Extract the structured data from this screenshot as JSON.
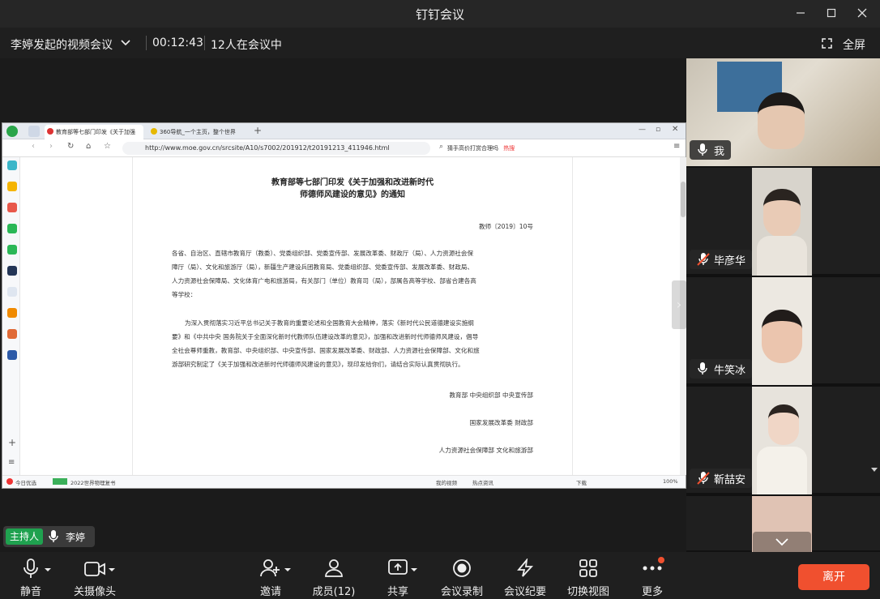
{
  "window": {
    "title": "钉钉会议"
  },
  "meeting": {
    "name": "李婷发起的视频会议",
    "duration": "00:12:43",
    "count": "12人在会议中",
    "fullscreen": "全屏"
  },
  "browser": {
    "tab1": "教育部等七部门印发《关于加强",
    "tab2": "360导航_一个主页，整个世界",
    "url": "http://www.moe.gov.cn/srcsite/A10/s7002/201912/t20191213_411946.html",
    "search": "猜手高价打赏合理吗",
    "hot": "热搜",
    "status_left": "今日优选",
    "status_mid": "2022世界物理复书",
    "status_video": "我的视频",
    "status_news": "热点资讯",
    "status_download": "下载",
    "zoom": "100%"
  },
  "document": {
    "title1": "教育部等七部门印发《关于加强和改进新时代",
    "title2": "师德师风建设的意见》的通知",
    "docno": "教师〔2019〕10号",
    "p1": [
      "各省、自治区、直辖市教育厅（教委）、党委组织部、党委宣传部、发展改革委、财政厅（局）、人力资源社会保",
      "障厅（局）、文化和旅游厅（局），新疆生产建设兵团教育局、党委组织部、党委宣传部、发展改革委、财政局、",
      "人力资源社会保障局、文化体育广电和旅游局，有关部门（单位）教育司（局），部属各高等学校、部省合建各高",
      "等学校："
    ],
    "p2": [
      "为深入贯彻落实习近平总书记关于教育的重要论述和全国教育大会精神，落实《新时代公民道德建设实施纲",
      "要》和《中共中央 国务院关于全面深化新时代教师队伍建设改革的意见》，加强和改进新时代师德师风建设，倡导",
      "全社会尊师重教，教育部、中央组织部、中央宣传部、国家发展改革委、财政部、人力资源社会保障部、文化和旅",
      "游部研究制定了《关于加强和改进新时代师德师风建设的意见》，现印发给你们，请结合实际认真贯彻执行。"
    ],
    "sign1": "教育部 中央组织部 中央宣传部",
    "sign2": "国家发展改革委 财政部",
    "sign3": "人力资源社会保障部 文化和旅游部"
  },
  "host": {
    "badge": "主持人",
    "name": "李婷"
  },
  "participants": [
    {
      "name": "我"
    },
    {
      "name": "毕彦华"
    },
    {
      "name": "牛笑冰"
    },
    {
      "name": "靳喆安"
    }
  ],
  "toolbar": {
    "mute": "静音",
    "camera": "关摄像头",
    "invite": "邀请",
    "members": "成员(12)",
    "share": "共享",
    "record": "会议录制",
    "minutes": "会议纪要",
    "view": "切换视图",
    "more": "更多",
    "leave": "离开"
  }
}
